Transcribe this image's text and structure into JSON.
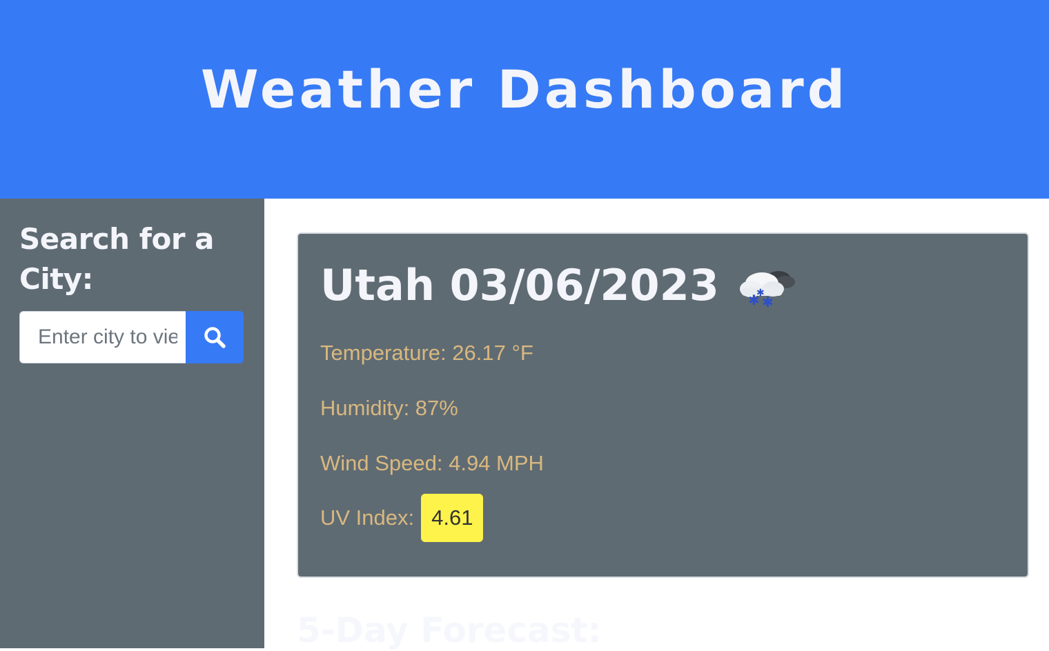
{
  "header": {
    "title": "Weather Dashboard"
  },
  "sidebar": {
    "heading": "Search for a City:",
    "search": {
      "placeholder": "Enter city to view weather",
      "value": "",
      "button_icon": "search-icon"
    }
  },
  "current": {
    "title": "Utah 03/06/2023",
    "icon": "snow-cloud-icon",
    "temperature": "Temperature: 26.17 °F",
    "humidity": "Humidity: 87%",
    "wind": "Wind Speed: 4.94 MPH",
    "uv_label": "UV Index:",
    "uv_value": "4.61"
  },
  "forecast": {
    "title": "5-Day Forecast:"
  },
  "colors": {
    "header_bg": "#377af5",
    "panel_bg": "#5f6b73",
    "stat_text": "#d9b87f",
    "uv_badge": "#fdf34b"
  }
}
